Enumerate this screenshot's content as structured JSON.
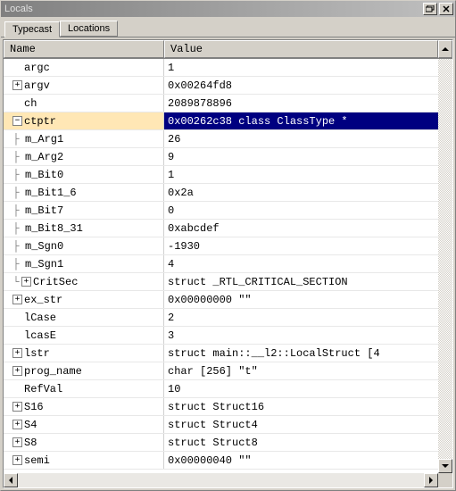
{
  "window": {
    "title": "Locals"
  },
  "tabs": [
    {
      "label": "Typecast",
      "active": true
    },
    {
      "label": "Locations",
      "active": false
    }
  ],
  "columns": {
    "name": "Name",
    "value": "Value"
  },
  "rows": [
    {
      "depth": 0,
      "expander": null,
      "conn": "",
      "name": "argc",
      "value": "1"
    },
    {
      "depth": 0,
      "expander": "plus",
      "conn": "",
      "name": "argv",
      "value": "0x00264fd8"
    },
    {
      "depth": 0,
      "expander": null,
      "conn": "",
      "name": "ch",
      "value": "2089878896"
    },
    {
      "depth": 0,
      "expander": "minus",
      "conn": "",
      "name": "ctptr",
      "value": "0x00262c38 class ClassType *",
      "selected": true
    },
    {
      "depth": 1,
      "expander": null,
      "conn": "tee",
      "name": "m_Arg1",
      "value": "26"
    },
    {
      "depth": 1,
      "expander": null,
      "conn": "tee",
      "name": "m_Arg2",
      "value": "9"
    },
    {
      "depth": 1,
      "expander": null,
      "conn": "tee",
      "name": "m_Bit0",
      "value": "1"
    },
    {
      "depth": 1,
      "expander": null,
      "conn": "tee",
      "name": "m_Bit1_6",
      "value": "0x2a"
    },
    {
      "depth": 1,
      "expander": null,
      "conn": "tee",
      "name": "m_Bit7",
      "value": "0"
    },
    {
      "depth": 1,
      "expander": null,
      "conn": "tee",
      "name": "m_Bit8_31",
      "value": "0xabcdef"
    },
    {
      "depth": 1,
      "expander": null,
      "conn": "tee",
      "name": "m_Sgn0",
      "value": "-1930"
    },
    {
      "depth": 1,
      "expander": null,
      "conn": "tee",
      "name": "m_Sgn1",
      "value": "4"
    },
    {
      "depth": 1,
      "expander": "plus",
      "conn": "end",
      "name": "CritSec",
      "value": "struct _RTL_CRITICAL_SECTION"
    },
    {
      "depth": 0,
      "expander": "plus",
      "conn": "",
      "name": "ex_str",
      "value": "0x00000000 \"\""
    },
    {
      "depth": 0,
      "expander": null,
      "conn": "",
      "name": "lCase",
      "value": "2"
    },
    {
      "depth": 0,
      "expander": null,
      "conn": "",
      "name": "lcasE",
      "value": "3"
    },
    {
      "depth": 0,
      "expander": "plus",
      "conn": "",
      "name": "lstr",
      "value": "struct main::__l2::LocalStruct [4"
    },
    {
      "depth": 0,
      "expander": "plus",
      "conn": "",
      "name": "prog_name",
      "value": "char [256] \"t\""
    },
    {
      "depth": 0,
      "expander": null,
      "conn": "",
      "name": "RefVal",
      "value": "10"
    },
    {
      "depth": 0,
      "expander": "plus",
      "conn": "",
      "name": "S16",
      "value": "struct Struct16"
    },
    {
      "depth": 0,
      "expander": "plus",
      "conn": "",
      "name": "S4",
      "value": "struct Struct4"
    },
    {
      "depth": 0,
      "expander": "plus",
      "conn": "",
      "name": "S8",
      "value": "struct Struct8"
    },
    {
      "depth": 0,
      "expander": "plus",
      "conn": "",
      "name": "semi",
      "value": "0x00000040 \"\""
    }
  ]
}
